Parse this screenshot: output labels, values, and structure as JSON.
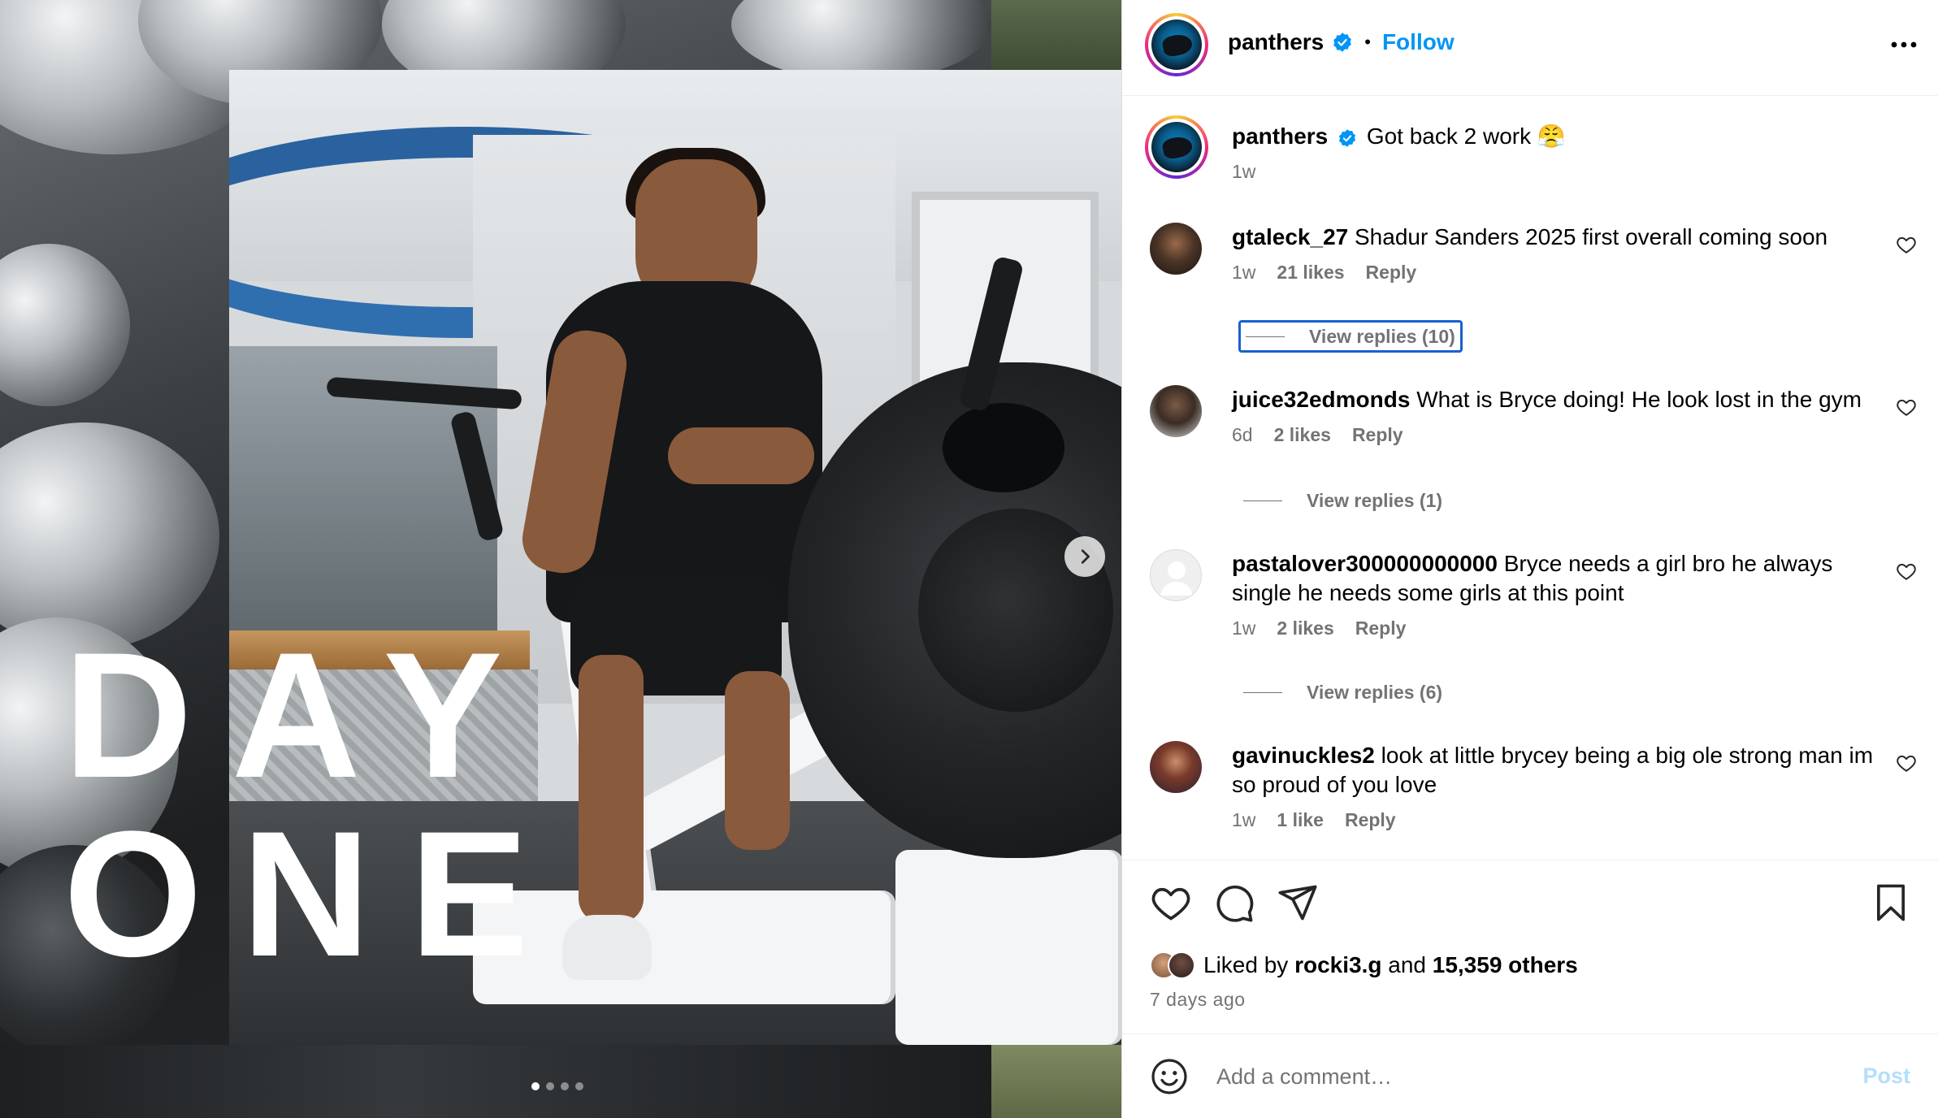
{
  "post": {
    "overlay_word_1": "DAY",
    "overlay_word_2": "ONE",
    "carousel_count": 4,
    "carousel_active_index": 0
  },
  "header": {
    "username": "panthers",
    "separator": "•",
    "follow_label": "Follow"
  },
  "caption": {
    "username": "panthers",
    "text": "Got back 2 work 😤",
    "time": "1w"
  },
  "comments": [
    {
      "username": "gtaleck_27",
      "text": "Shadur Sanders 2025 first overall coming soon",
      "time": "1w",
      "likes": "21 likes",
      "reply_label": "Reply",
      "view_replies": "View replies (10)"
    },
    {
      "username": "juice32edmonds",
      "text": "What is Bryce doing! He look lost in the gym",
      "time": "6d",
      "likes": "2 likes",
      "reply_label": "Reply",
      "view_replies": "View replies (1)"
    },
    {
      "username": "pastalover300000000000",
      "text": "Bryce needs a girl bro he always single he needs some girls at this point",
      "time": "1w",
      "likes": "2 likes",
      "reply_label": "Reply",
      "view_replies": "View replies (6)"
    },
    {
      "username": "gavinuckles2",
      "text": "look at little brycey being a big ole strong man im so proud of you love",
      "time": "1w",
      "likes": "1 like",
      "reply_label": "Reply"
    }
  ],
  "likes": {
    "prefix": "Liked by",
    "user": "rocki3.g",
    "connector": "and",
    "others": "15,359 others"
  },
  "time_ago": "7 days ago",
  "add_comment": {
    "placeholder": "Add a comment…",
    "post_label": "Post"
  },
  "colors": {
    "accent": "#0095f6",
    "verified": "#0095f6",
    "muted": "#737373",
    "post_disabled": "#b2dffc",
    "focus_outline": "#1a5fd0"
  },
  "icons": [
    "verified-badge-icon",
    "more-options-icon",
    "heart-icon",
    "comment-icon",
    "share-icon",
    "bookmark-icon",
    "emoji-icon",
    "chevron-right-icon"
  ]
}
